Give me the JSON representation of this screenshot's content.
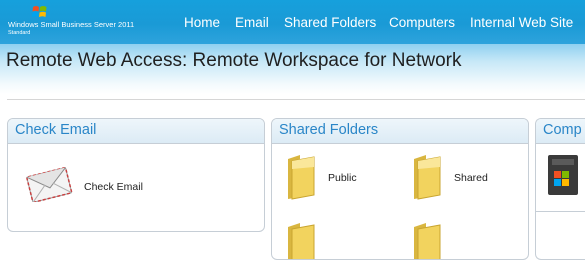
{
  "header": {
    "logo_text": "Windows Small Business Server 2011",
    "logo_edition": "Standard",
    "nav": [
      {
        "label": "Home"
      },
      {
        "label": "Email"
      },
      {
        "label": "Shared Folders"
      },
      {
        "label": "Computers"
      },
      {
        "label": "Internal Web Site"
      }
    ]
  },
  "page": {
    "title": "Remote Web Access: Remote Workspace for Network"
  },
  "cards": {
    "email": {
      "title": "Check Email",
      "items": [
        {
          "label": "Check Email",
          "icon": "envelope-icon"
        }
      ]
    },
    "folders": {
      "title": "Shared Folders",
      "items": [
        {
          "label": "Public",
          "icon": "folder-icon"
        },
        {
          "label": "Shared",
          "icon": "folder-icon"
        }
      ]
    },
    "computers": {
      "title": "Comp"
    }
  },
  "colors": {
    "nav_bar": "#1a9ad6",
    "card_title": "#2a86c8",
    "card_border": "#c6ced6"
  }
}
